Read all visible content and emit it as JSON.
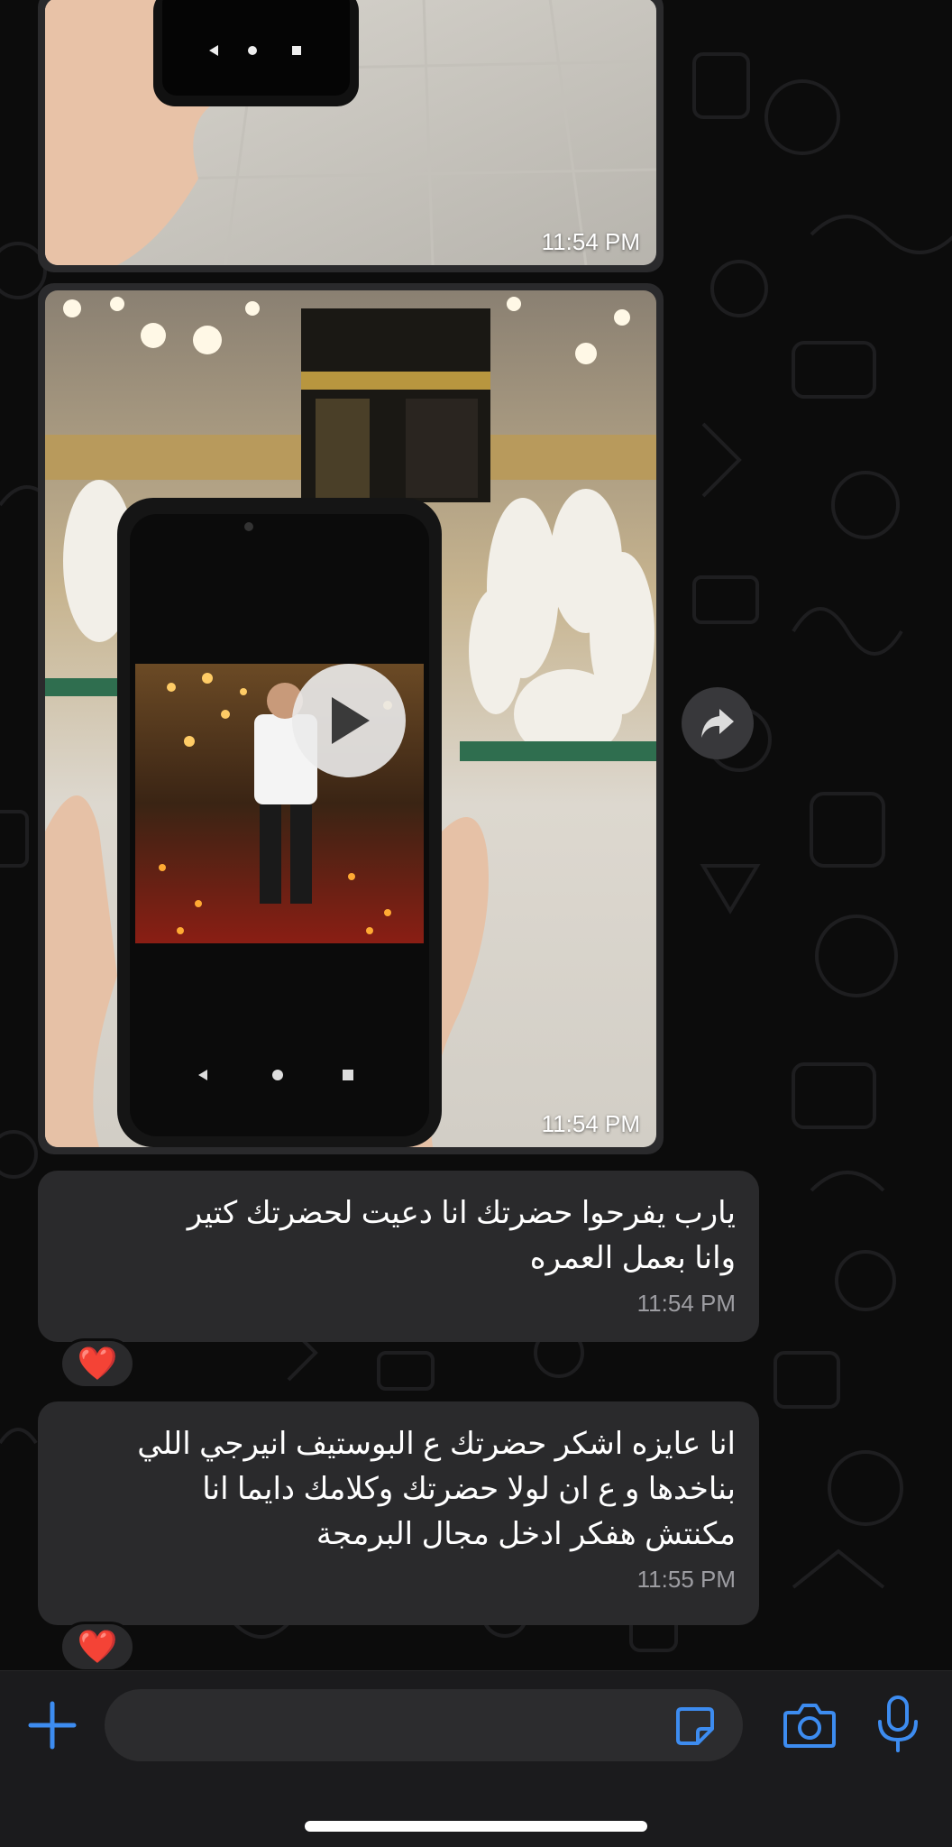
{
  "messages": {
    "media1": {
      "time": "11:54 PM"
    },
    "media2": {
      "time": "11:54 PM"
    },
    "text1": {
      "lines": [
        "يارب يفرحوا حضرتك انا دعيت لحضرتك كتير",
        "وانا بعمل العمره"
      ],
      "time": "11:54 PM",
      "reaction": "❤️"
    },
    "text2": {
      "lines": [
        "انا عايزه اشكر حضرتك ع البوستيف انيرجي اللي",
        "بناخدها و ع ان لولا حضرتك وكلامك دايما انا",
        "مكنتش هفكر ادخل مجال البرمجة"
      ],
      "time": "11:55 PM",
      "reaction": "❤️"
    }
  },
  "icons": {
    "forward": "forward-arrow-icon",
    "play": "play-icon",
    "plus": "plus-icon",
    "sticker": "sticker-icon",
    "camera": "camera-icon",
    "mic": "microphone-icon"
  },
  "input": {
    "placeholder": ""
  },
  "colors": {
    "accent": "#3d8cf0",
    "bubble": "#2a2a2c",
    "reaction_heart": "#e0252d",
    "background": "#0c0c0c"
  }
}
